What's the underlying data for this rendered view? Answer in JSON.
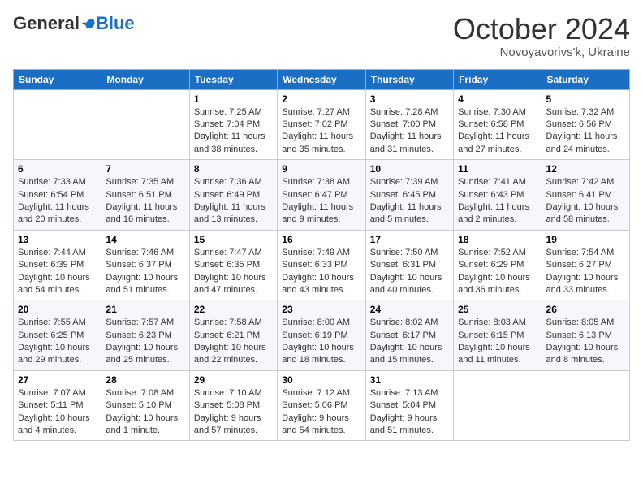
{
  "header": {
    "logo_general": "General",
    "logo_blue": "Blue",
    "month_title": "October 2024",
    "location": "Novoyavorivs'k, Ukraine"
  },
  "weekdays": [
    "Sunday",
    "Monday",
    "Tuesday",
    "Wednesday",
    "Thursday",
    "Friday",
    "Saturday"
  ],
  "weeks": [
    [
      {
        "day": "",
        "info": ""
      },
      {
        "day": "",
        "info": ""
      },
      {
        "day": "1",
        "info": "Sunrise: 7:25 AM\nSunset: 7:04 PM\nDaylight: 11 hours and 38 minutes."
      },
      {
        "day": "2",
        "info": "Sunrise: 7:27 AM\nSunset: 7:02 PM\nDaylight: 11 hours and 35 minutes."
      },
      {
        "day": "3",
        "info": "Sunrise: 7:28 AM\nSunset: 7:00 PM\nDaylight: 11 hours and 31 minutes."
      },
      {
        "day": "4",
        "info": "Sunrise: 7:30 AM\nSunset: 6:58 PM\nDaylight: 11 hours and 27 minutes."
      },
      {
        "day": "5",
        "info": "Sunrise: 7:32 AM\nSunset: 6:56 PM\nDaylight: 11 hours and 24 minutes."
      }
    ],
    [
      {
        "day": "6",
        "info": "Sunrise: 7:33 AM\nSunset: 6:54 PM\nDaylight: 11 hours and 20 minutes."
      },
      {
        "day": "7",
        "info": "Sunrise: 7:35 AM\nSunset: 6:51 PM\nDaylight: 11 hours and 16 minutes."
      },
      {
        "day": "8",
        "info": "Sunrise: 7:36 AM\nSunset: 6:49 PM\nDaylight: 11 hours and 13 minutes."
      },
      {
        "day": "9",
        "info": "Sunrise: 7:38 AM\nSunset: 6:47 PM\nDaylight: 11 hours and 9 minutes."
      },
      {
        "day": "10",
        "info": "Sunrise: 7:39 AM\nSunset: 6:45 PM\nDaylight: 11 hours and 5 minutes."
      },
      {
        "day": "11",
        "info": "Sunrise: 7:41 AM\nSunset: 6:43 PM\nDaylight: 11 hours and 2 minutes."
      },
      {
        "day": "12",
        "info": "Sunrise: 7:42 AM\nSunset: 6:41 PM\nDaylight: 10 hours and 58 minutes."
      }
    ],
    [
      {
        "day": "13",
        "info": "Sunrise: 7:44 AM\nSunset: 6:39 PM\nDaylight: 10 hours and 54 minutes."
      },
      {
        "day": "14",
        "info": "Sunrise: 7:46 AM\nSunset: 6:37 PM\nDaylight: 10 hours and 51 minutes."
      },
      {
        "day": "15",
        "info": "Sunrise: 7:47 AM\nSunset: 6:35 PM\nDaylight: 10 hours and 47 minutes."
      },
      {
        "day": "16",
        "info": "Sunrise: 7:49 AM\nSunset: 6:33 PM\nDaylight: 10 hours and 43 minutes."
      },
      {
        "day": "17",
        "info": "Sunrise: 7:50 AM\nSunset: 6:31 PM\nDaylight: 10 hours and 40 minutes."
      },
      {
        "day": "18",
        "info": "Sunrise: 7:52 AM\nSunset: 6:29 PM\nDaylight: 10 hours and 36 minutes."
      },
      {
        "day": "19",
        "info": "Sunrise: 7:54 AM\nSunset: 6:27 PM\nDaylight: 10 hours and 33 minutes."
      }
    ],
    [
      {
        "day": "20",
        "info": "Sunrise: 7:55 AM\nSunset: 6:25 PM\nDaylight: 10 hours and 29 minutes."
      },
      {
        "day": "21",
        "info": "Sunrise: 7:57 AM\nSunset: 6:23 PM\nDaylight: 10 hours and 25 minutes."
      },
      {
        "day": "22",
        "info": "Sunrise: 7:58 AM\nSunset: 6:21 PM\nDaylight: 10 hours and 22 minutes."
      },
      {
        "day": "23",
        "info": "Sunrise: 8:00 AM\nSunset: 6:19 PM\nDaylight: 10 hours and 18 minutes."
      },
      {
        "day": "24",
        "info": "Sunrise: 8:02 AM\nSunset: 6:17 PM\nDaylight: 10 hours and 15 minutes."
      },
      {
        "day": "25",
        "info": "Sunrise: 8:03 AM\nSunset: 6:15 PM\nDaylight: 10 hours and 11 minutes."
      },
      {
        "day": "26",
        "info": "Sunrise: 8:05 AM\nSunset: 6:13 PM\nDaylight: 10 hours and 8 minutes."
      }
    ],
    [
      {
        "day": "27",
        "info": "Sunrise: 7:07 AM\nSunset: 5:11 PM\nDaylight: 10 hours and 4 minutes."
      },
      {
        "day": "28",
        "info": "Sunrise: 7:08 AM\nSunset: 5:10 PM\nDaylight: 10 hours and 1 minute."
      },
      {
        "day": "29",
        "info": "Sunrise: 7:10 AM\nSunset: 5:08 PM\nDaylight: 9 hours and 57 minutes."
      },
      {
        "day": "30",
        "info": "Sunrise: 7:12 AM\nSunset: 5:06 PM\nDaylight: 9 hours and 54 minutes."
      },
      {
        "day": "31",
        "info": "Sunrise: 7:13 AM\nSunset: 5:04 PM\nDaylight: 9 hours and 51 minutes."
      },
      {
        "day": "",
        "info": ""
      },
      {
        "day": "",
        "info": ""
      }
    ]
  ]
}
